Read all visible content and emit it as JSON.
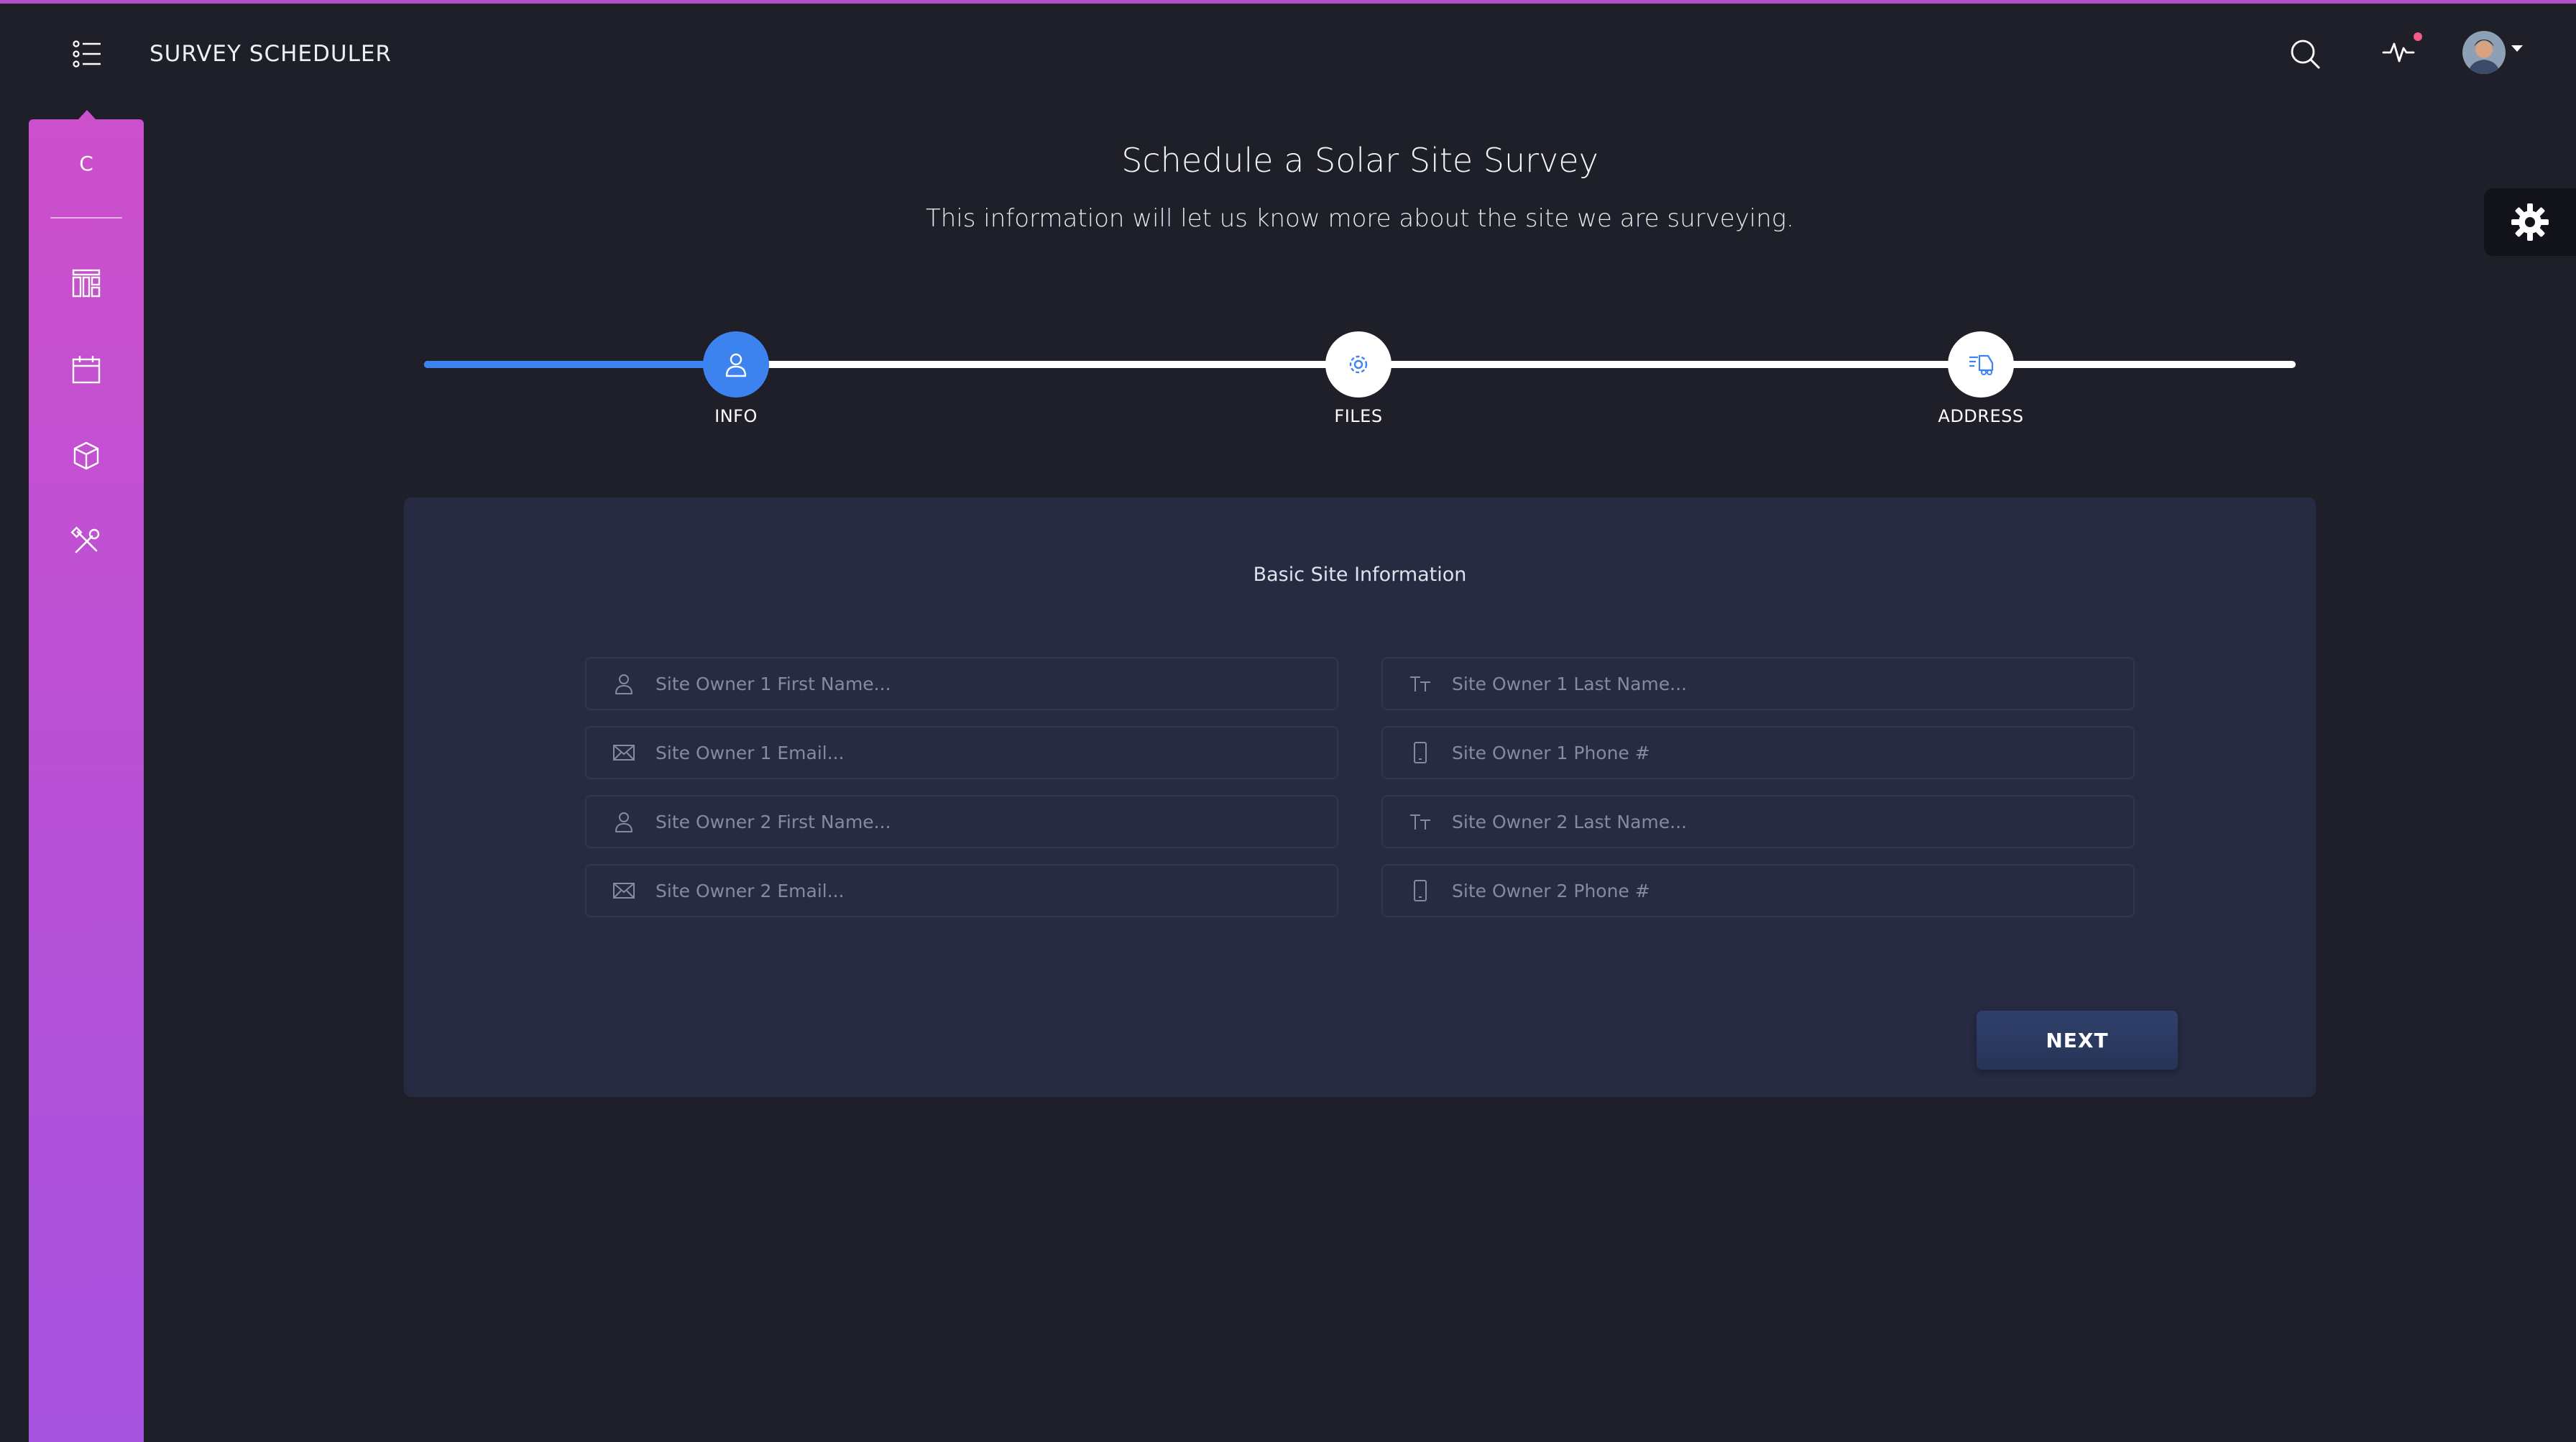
{
  "app": {
    "title": "SURVEY SCHEDULER"
  },
  "sidebar": {
    "logo": "C",
    "items": [
      {
        "name": "dashboard",
        "icon": "layout-icon"
      },
      {
        "name": "calendar",
        "icon": "calendar-icon"
      },
      {
        "name": "packages",
        "icon": "box-icon"
      },
      {
        "name": "tools",
        "icon": "tools-icon"
      }
    ]
  },
  "header": {
    "title": "Schedule a Solar Site Survey",
    "subtitle": "This information will let us know more about the site we are surveying."
  },
  "wizard": {
    "progress": 0.167,
    "steps": [
      {
        "label": "INFO",
        "icon": "user-icon",
        "active": true
      },
      {
        "label": "FILES",
        "icon": "gear-icon",
        "active": false
      },
      {
        "label": "ADDRESS",
        "icon": "delivery-icon",
        "active": false
      }
    ]
  },
  "form": {
    "title": "Basic Site Information",
    "fields": {
      "owner1_first": {
        "placeholder": "Site Owner 1 First Name...",
        "value": ""
      },
      "owner1_last": {
        "placeholder": "Site Owner 1 Last Name...",
        "value": ""
      },
      "owner1_email": {
        "placeholder": "Site Owner 1 Email...",
        "value": ""
      },
      "owner1_phone": {
        "placeholder": "Site Owner 1 Phone #",
        "value": ""
      },
      "owner2_first": {
        "placeholder": "Site Owner 2 First Name...",
        "value": ""
      },
      "owner2_last": {
        "placeholder": "Site Owner 2 Last Name...",
        "value": ""
      },
      "owner2_email": {
        "placeholder": "Site Owner 2 Email...",
        "value": ""
      },
      "owner2_phone": {
        "placeholder": "Site Owner 2 Phone #",
        "value": ""
      }
    },
    "next_label": "NEXT"
  },
  "colors": {
    "accent": "#3d83f0",
    "sidebar_top": "#cc4fcb",
    "sidebar_bottom": "#a653e0",
    "background": "#1e1f28",
    "card": "#262b42",
    "notification": "#f15d8a"
  }
}
